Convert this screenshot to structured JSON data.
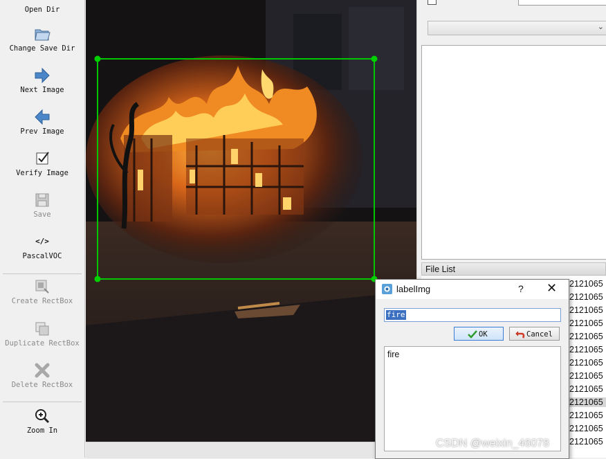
{
  "toolbar": {
    "open_dir": "Open Dir",
    "change_save_dir": "Change Save Dir",
    "next_image": "Next Image",
    "prev_image": "Prev Image",
    "verify_image": "Verify Image",
    "save": "Save",
    "format": "PascalVOC",
    "create_rectbox": "Create RectBox",
    "duplicate_rectbox": "Duplicate RectBox",
    "delete_rectbox": "Delete RectBox",
    "zoom_in": "Zoom In"
  },
  "right_panel": {
    "file_list_header": "File List",
    "file_rows": [
      "2121065",
      "2121065",
      "2121065",
      "2121065",
      "2121065",
      "2121065",
      "2121065",
      "2121065",
      "2121065",
      "2121065",
      "2121065",
      "2121065",
      "2121065"
    ],
    "selected_row_index": 9
  },
  "dialog": {
    "title": "labelImg",
    "help": "?",
    "input_value": "fire",
    "ok_label": "OK",
    "cancel_label": "Cancel",
    "labels": [
      "fire"
    ]
  },
  "annotation": {
    "label": "fire",
    "box_color": "#00c800"
  },
  "watermark": "CSDN @weixin_46078"
}
